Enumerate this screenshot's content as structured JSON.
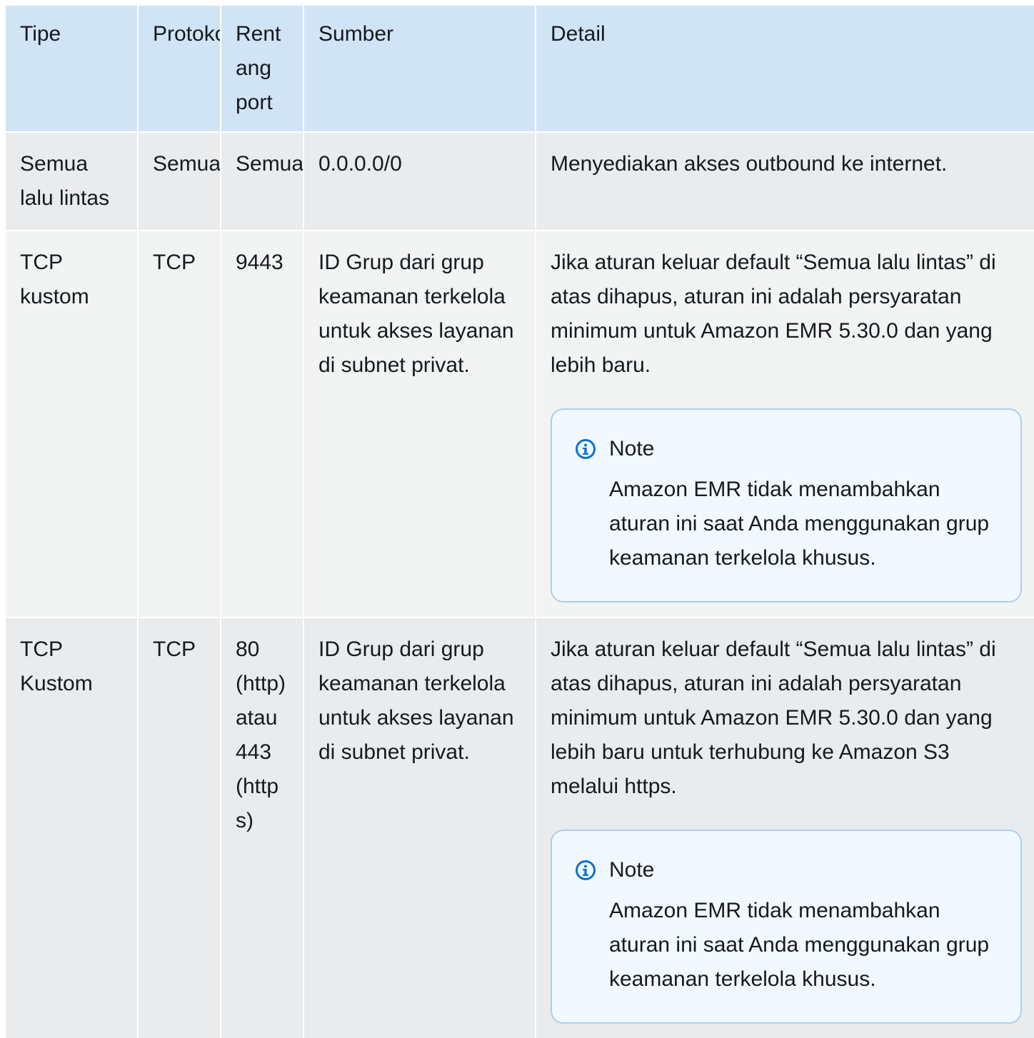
{
  "table": {
    "headers": {
      "type": "Tipe",
      "protocol": "Protokol",
      "port_range": "Rentang port",
      "source": "Sumber",
      "detail": "Detail"
    },
    "rows": [
      {
        "type": "Semua lalu lintas",
        "protocol": "Semua",
        "port_range": "Semua",
        "source": "0.0.0.0/0",
        "detail": "Menyediakan akses outbound ke internet."
      },
      {
        "type": "TCP kustom",
        "protocol": "TCP",
        "port_range": "9443",
        "source": "ID Grup dari grup keamanan terkelola untuk akses layanan di subnet privat.",
        "detail": "Jika aturan keluar default “Semua lalu lintas” di atas dihapus, aturan ini adalah persyaratan minimum untuk Amazon EMR 5.30.0 dan yang lebih baru.",
        "note": {
          "title": "Note",
          "body": "Amazon EMR tidak menambahkan aturan ini saat Anda menggunakan grup keamanan terkelola khusus."
        }
      },
      {
        "type": "TCP Kustom",
        "protocol": "TCP",
        "port_range": "80 (http) atau 443 (https)",
        "source": "ID Grup dari grup keamanan terkelola untuk akses layanan di subnet privat.",
        "detail": "Jika aturan keluar default “Semua lalu lintas” di atas dihapus, aturan ini adalah persyaratan minimum untuk Amazon EMR 5.30.0 dan yang lebih baru untuk terhubung ke Amazon S3 melalui https.",
        "note": {
          "title": "Note",
          "body": "Amazon EMR tidak menambahkan aturan ini saat Anda menggunakan grup keamanan terkelola khusus."
        }
      }
    ]
  },
  "colors": {
    "header_bg": "#d1e4f6",
    "row_dark": "#e9ebed",
    "row_light": "#f2f3f3",
    "note_bg": "#f1f8ff",
    "note_border": "#a8d0f2",
    "info_icon": "#0972d3"
  },
  "icons": {
    "note_icon": "info-circle-icon"
  }
}
